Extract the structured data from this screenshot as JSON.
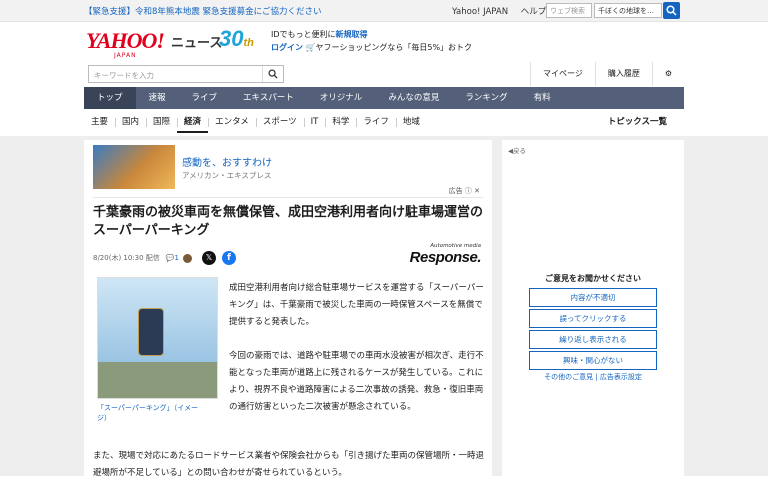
{
  "topbar": {
    "alert": "【緊急支援】令和8年熊本地震 緊急支援募金にご協力ください",
    "links": [
      "Yahoo! JAPAN",
      "ヘルプ"
    ],
    "search_placeholder": "ウェブ検索",
    "search_value": "千ぼくの地球を…"
  },
  "header": {
    "logo": "YAHOO!",
    "logo_sub": "JAPAN",
    "section": "ニュース",
    "anniv_num": "30",
    "anniv_suffix": "th",
    "promo_line1_prefix": "IDでもっと便利に",
    "promo_line1_link": "新規取得",
    "promo_login": "ログイン",
    "promo_line2": "ヤフーショッピングなら「毎日5%」おトク"
  },
  "search": {
    "placeholder": "キーワードを入力",
    "right_links": [
      "マイページ",
      "購入履歴"
    ]
  },
  "nav": [
    "トップ",
    "速報",
    "ライブ",
    "エキスパート",
    "オリジナル",
    "みんなの意見",
    "ランキング",
    "有料"
  ],
  "subnav": [
    "主要",
    "国内",
    "国際",
    "経済",
    "エンタメ",
    "スポーツ",
    "IT",
    "科学",
    "ライフ",
    "地域"
  ],
  "subnav_topics": "トピックス一覧",
  "ad": {
    "title": "感動を、おすすわけ",
    "sponsor": "アメリカン・エキスプレス",
    "label": "広告"
  },
  "article": {
    "title": "千葉豪雨の被災車両を無償保管、成田空港利用者向け駐車場運営のスーパーパーキング",
    "date": "8/20(木) 10:30 配信",
    "comments": "1",
    "brand_small": "Automotive media",
    "brand_main": "Response.",
    "caption": "「スーパーパーキング」（イメージ）",
    "p1": "成田空港利用者向け総合駐車場サービスを運営する「スーパーパーキング」は、千葉豪雨で被災した車両の一時保管スペースを無償で提供すると発表した。",
    "p2": "今回の豪雨では、道路や駐車場での車両水没被害が相次ぎ、走行不能となった車両が道路上に残されるケースが発生している。これにより、視界不良や道路障害による二次事故の誘発、救急・復旧車両の通行妨害といった二次被害が懸念されている。",
    "p3": "また、現場で対応にあたるロードサービス業者や保険会社からも「引き揚げた車両の保管場所・一時退避場所が不足している」との問い合わせが寄せられているという。"
  },
  "side": {
    "back": "戻る",
    "feedback_head": "ご意見をお聞かせください",
    "feedback_buttons": [
      "内容が不適切",
      "誤ってクリックする",
      "繰り返し表示される",
      "興味・関心がない"
    ],
    "feedback_foot": "その他のご意見 | 広告表示設定"
  },
  "colors": {
    "nav_bg": "#54607a",
    "link": "#1565c0",
    "brand_red": "#e0001c"
  }
}
